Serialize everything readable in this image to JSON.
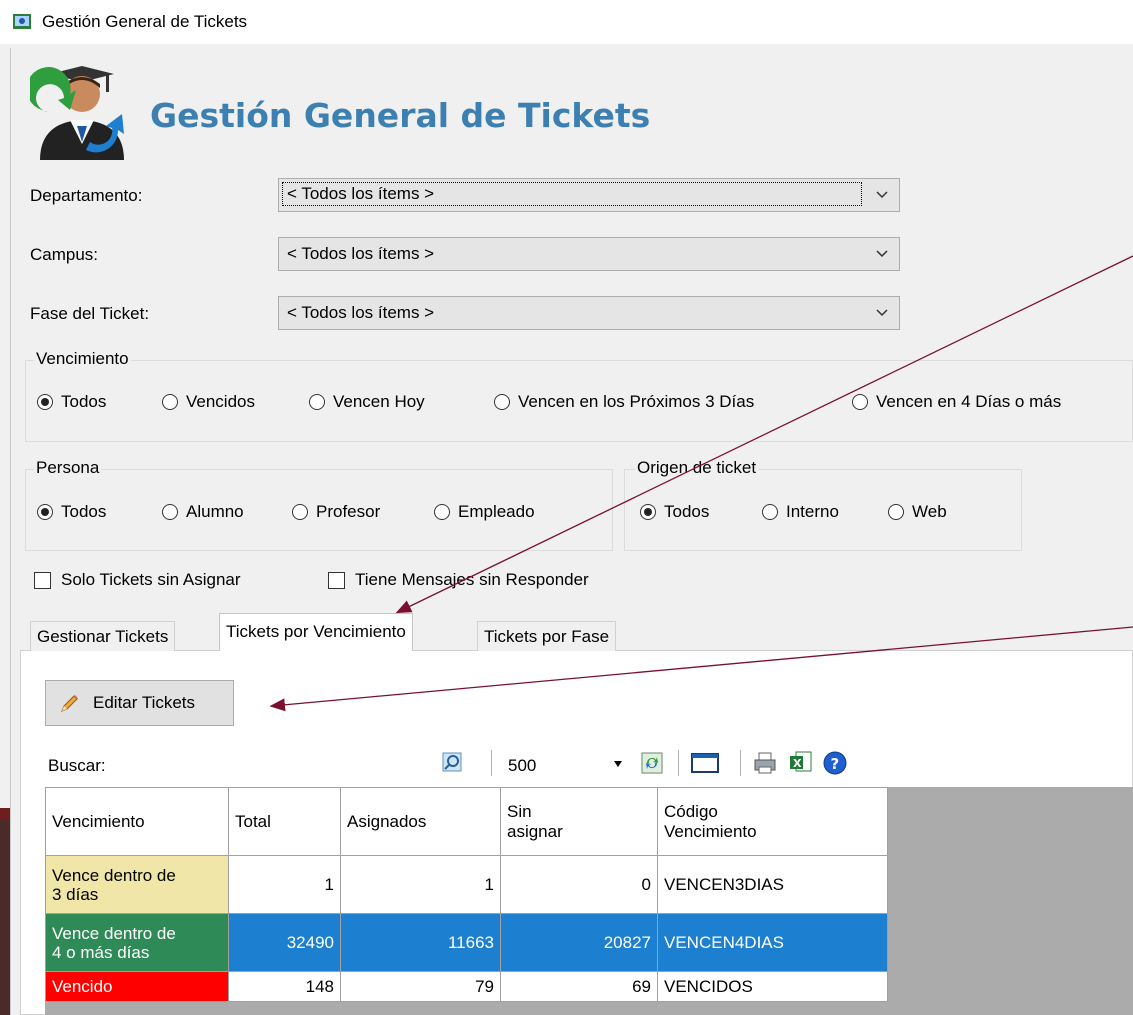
{
  "window": {
    "title": "Gestión General de Tickets"
  },
  "header": {
    "title": "Gestión General de Tickets"
  },
  "filters": [
    {
      "label": "Departamento:",
      "value": "< Todos los ítems >"
    },
    {
      "label": "Campus:",
      "value": "< Todos los ítems >"
    },
    {
      "label": "Fase del Ticket:",
      "value": "< Todos los ítems >"
    }
  ],
  "vencimiento": {
    "legend": "Vencimiento",
    "options": [
      "Todos",
      "Vencidos",
      "Vencen Hoy",
      "Vencen en los Próximos 3 Días",
      "Vencen en 4 Días o más"
    ],
    "selected": "Todos"
  },
  "persona": {
    "legend": "Persona",
    "options": [
      "Todos",
      "Alumno",
      "Profesor",
      "Empleado"
    ],
    "selected": "Todos"
  },
  "origen": {
    "legend": "Origen de ticket",
    "options": [
      "Todos",
      "Interno",
      "Web"
    ],
    "selected": "Todos"
  },
  "checks": [
    "Solo Tickets sin Asignar",
    "Tiene Mensajes sin Responder"
  ],
  "tabs": [
    "Gestionar Tickets",
    "Tickets por Vencimiento",
    "Tickets por Fase"
  ],
  "active_tab": "Tickets por Vencimiento",
  "edit_button": {
    "label": "Editar Tickets"
  },
  "toolbar": {
    "search_label": "Buscar:",
    "page_size": "500"
  },
  "grid": {
    "columns": [
      "Vencimiento",
      "Total",
      "Asignados",
      "Sin asignar",
      "Código Vencimiento"
    ],
    "column_lines": {
      "sin_asignar": [
        "Sin",
        "asignar"
      ],
      "codigo": [
        "Código",
        "Vencimiento"
      ]
    },
    "rows": [
      {
        "vencimiento": [
          "Vence dentro de",
          "3 días"
        ],
        "total": "1",
        "asignados": "1",
        "sin_asignar": "0",
        "codigo": "VENCEN3DIAS",
        "status_color": "#f0e6a8"
      },
      {
        "vencimiento": [
          "Vence dentro de",
          "4 o más días"
        ],
        "total": "32490",
        "asignados": "11663",
        "sin_asignar": "20827",
        "codigo": "VENCEN4DIAS",
        "status_color": "#2e8b57",
        "selected_color": "#1c7fd0"
      },
      {
        "vencimiento": [
          "Vencido"
        ],
        "total": "148",
        "asignados": "79",
        "sin_asignar": "69",
        "codigo": "VENCIDOS",
        "status_color": "#ff0000"
      }
    ]
  },
  "colors": {
    "title_blue": "#3c7fb1",
    "arrow": "#7a1030"
  }
}
